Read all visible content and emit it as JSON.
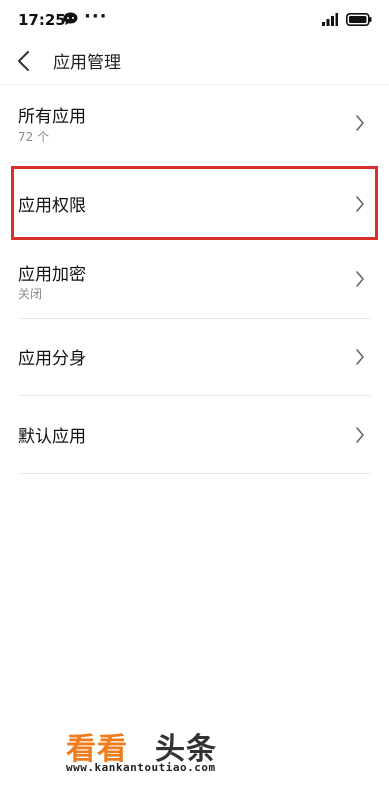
{
  "status_bar": {
    "time": "17:25",
    "dots": "···",
    "chat_icon": "chat-bubble-icon",
    "signal_icon": "signal-icon",
    "battery_icon": "battery-icon"
  },
  "header": {
    "back_icon": "chevron-left-icon",
    "title": "应用管理"
  },
  "menu": {
    "items": [
      {
        "label": "所有应用",
        "sub": "72 个"
      },
      {
        "label": "应用权限",
        "sub": ""
      },
      {
        "label": "应用加密",
        "sub": "关闭"
      },
      {
        "label": "应用分身",
        "sub": ""
      },
      {
        "label": "默认应用",
        "sub": ""
      }
    ],
    "chevron_icon": "chevron-right-icon"
  },
  "highlight": {
    "color": "#d9302c",
    "target": "应用权限"
  },
  "watermark": {
    "brand_orange": "看看",
    "brand_dark": "头条",
    "url": "www.kankantoutiao.com",
    "orange_color": "#f07b1d"
  }
}
